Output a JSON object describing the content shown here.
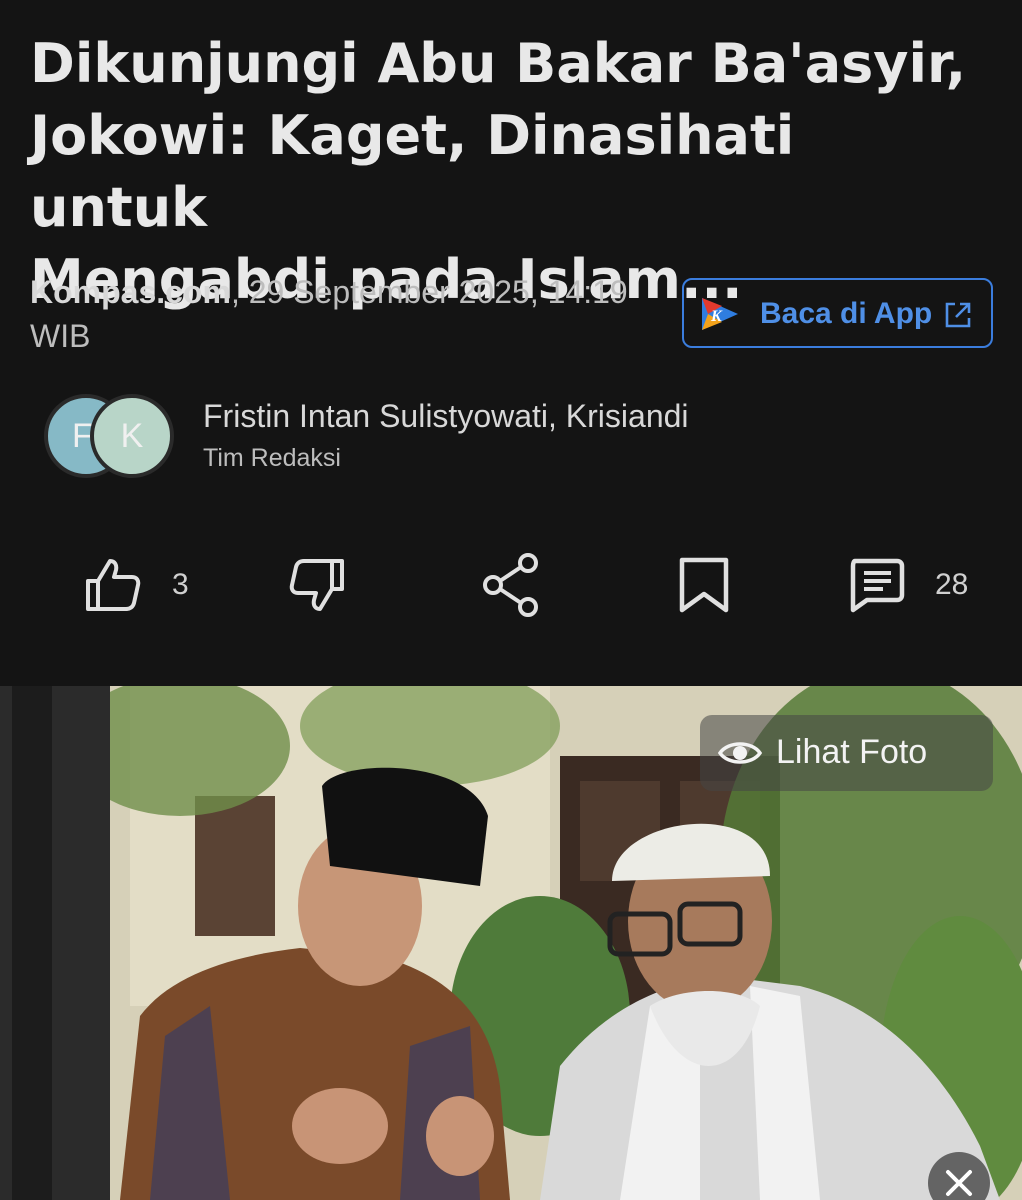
{
  "article": {
    "title_lines": [
      "Dikunjungi Abu Bakar Ba'asyir,",
      "Jokowi: Kaget, Dinasihati untuk",
      "Mengabdi pada Islam..."
    ],
    "source": "Kompas.com",
    "date": ", 29 September 2025, 14:19",
    "timezone": "WIB"
  },
  "app_button": {
    "label": "Baca di App",
    "logo_letter": "K"
  },
  "authors": {
    "avatars": [
      "F",
      "K"
    ],
    "names": "Fristin Intan Sulistyowati,  Krisiandi",
    "team": "Tim Redaksi"
  },
  "actions": {
    "like_count": "3",
    "comment_count": "28"
  },
  "photo": {
    "view_label": "Lihat Foto"
  },
  "colors": {
    "background": "#141414",
    "accent": "#3b7ddd",
    "accent_text": "#4f8fe6"
  }
}
